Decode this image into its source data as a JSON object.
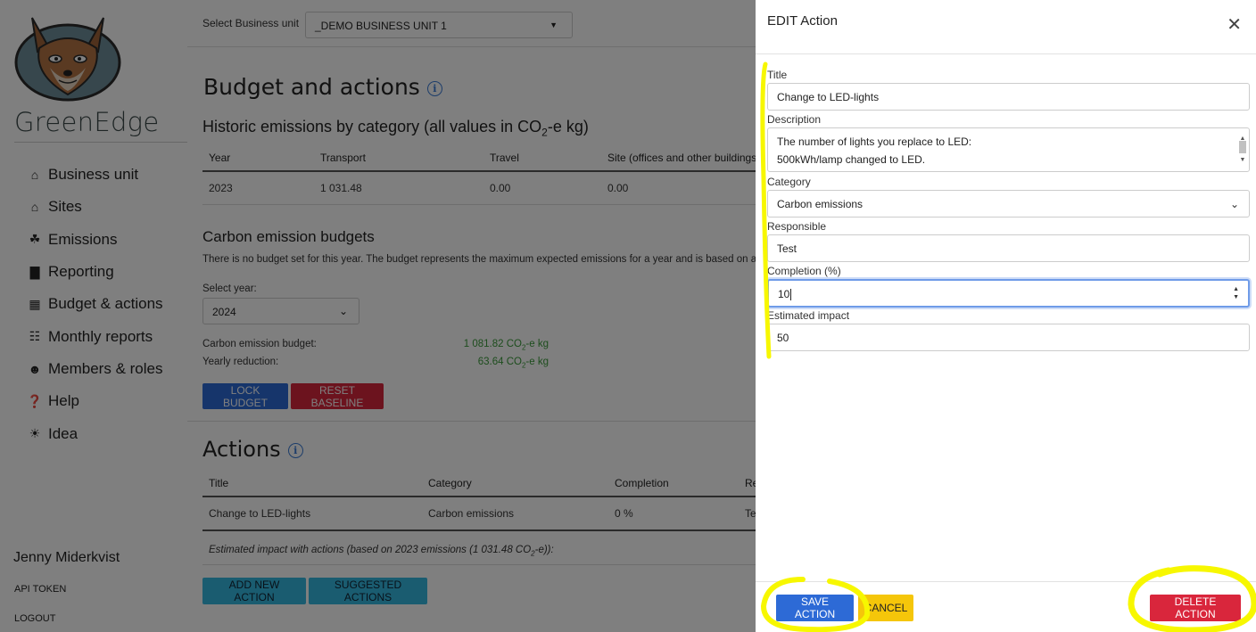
{
  "sidebar": {
    "brand": "GreenEdge",
    "items": [
      {
        "label": "Business unit",
        "icon": "home-icon"
      },
      {
        "label": "Sites",
        "icon": "house-icon"
      },
      {
        "label": "Emissions",
        "icon": "seedling-icon"
      },
      {
        "label": "Reporting",
        "icon": "bar-chart-icon"
      },
      {
        "label": "Budget & actions",
        "icon": "calculator-icon"
      },
      {
        "label": "Monthly reports",
        "icon": "clipboard-icon"
      },
      {
        "label": "Members & roles",
        "icon": "users-icon"
      },
      {
        "label": "Help",
        "icon": "help-icon"
      },
      {
        "label": "Idea",
        "icon": "lightbulb-icon"
      }
    ],
    "user_name": "Jenny Miderkvist",
    "api_token": "API TOKEN",
    "logout": "LOGOUT"
  },
  "main": {
    "business_unit_label": "Select Business unit",
    "business_unit_value": "_DEMO BUSINESS UNIT 1",
    "page_title": "Budget and actions",
    "historic_title": "Historic emissions by category",
    "historic_subtitle_pre": "(all values in CO",
    "historic_subtitle_sub": "2",
    "historic_subtitle_post": "-e kg)",
    "historic_columns": [
      "Year",
      "Transport",
      "Travel",
      "Site (offices and other buildings)"
    ],
    "historic_rows": [
      [
        "2023",
        "1 031.48",
        "0.00",
        "0.00"
      ]
    ],
    "budgets_title": "Carbon emission budgets",
    "budget_note": "There is no budget set for this year. The budget represents the maximum expected emissions for a year and is based on an ec",
    "select_year_label": "Select year:",
    "select_year_value": "2024",
    "budget_label": "Carbon emission budget:",
    "budget_value_num": "1 081.82 CO",
    "budget_value_sub": "2",
    "budget_value_unit": "-e kg",
    "reduction_label": "Yearly reduction:",
    "reduction_value_num": "63.64 CO",
    "reduction_value_sub": "2",
    "reduction_value_unit": "-e kg",
    "lock_budget": "LOCK BUDGET",
    "reset_baseline": "RESET BASELINE",
    "actions_title": "Actions",
    "actions_columns": [
      "Title",
      "Category",
      "Completion",
      "Re"
    ],
    "actions_rows": [
      [
        "Change to LED-lights",
        "Carbon emissions",
        "0 %",
        "Tes"
      ]
    ],
    "estimated_pre": "Estimated impact with actions (based on 2023 emissions (1 031.48 CO",
    "estimated_sub": "2",
    "estimated_post": "-e)):",
    "add_new_action": "ADD NEW ACTION",
    "suggested_actions": "SUGGESTED ACTIONS"
  },
  "drawer": {
    "title": "EDIT Action",
    "fields": {
      "title_label": "Title",
      "title_value": "Change to LED-lights",
      "description_label": "Description",
      "description_line1": "The number of lights you replace to LED:",
      "description_line2": "500kWh/lamp changed to LED.",
      "category_label": "Category",
      "category_value": "Carbon emissions",
      "responsible_label": "Responsible",
      "responsible_value": "Test",
      "completion_label": "Completion (%)",
      "completion_value": "10",
      "impact_label": "Estimated impact",
      "impact_value": "50"
    },
    "save_action": "SAVE ACTION",
    "cancel": "CANCEL",
    "delete_action": "DELETE ACTION"
  },
  "colors": {
    "primary_blue": "#2d6ad6",
    "danger_red": "#d9263c",
    "info_teal": "#35b9e0",
    "warning_yellow": "#f5c60a",
    "success_green": "#3a9a3a",
    "highlight_yellow": "#f7f700"
  }
}
